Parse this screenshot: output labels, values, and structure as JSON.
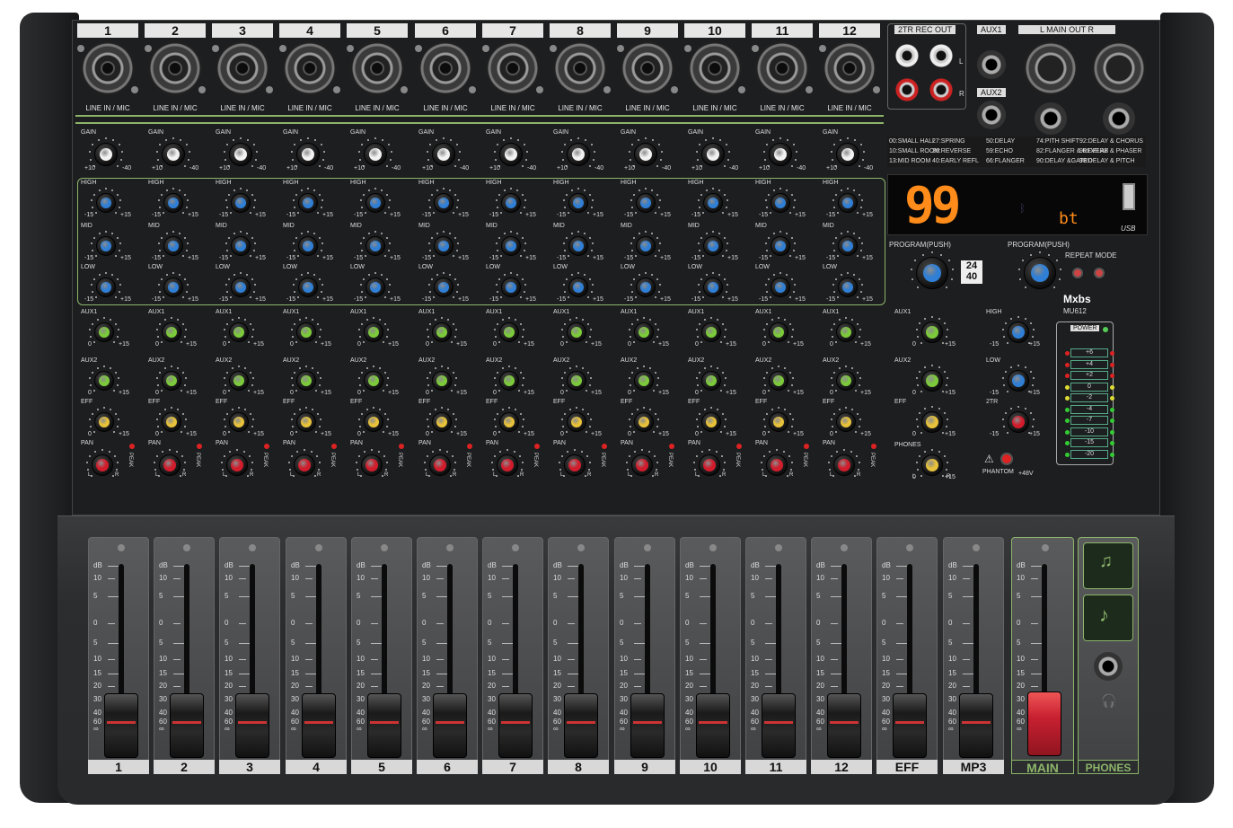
{
  "channels": [
    "1",
    "2",
    "3",
    "4",
    "5",
    "6",
    "7",
    "8",
    "9",
    "10",
    "11",
    "12"
  ],
  "faders": [
    "1",
    "2",
    "3",
    "4",
    "5",
    "6",
    "7",
    "8",
    "9",
    "10",
    "11",
    "12",
    "EFF",
    "MP3"
  ],
  "master": {
    "main": "MAIN",
    "phones": "PHONES"
  },
  "labels": {
    "line_in_mic": "LINE IN / MIC",
    "gain": "GAIN",
    "gain_min": "+10",
    "gain_max": "-40",
    "high": "HIGH",
    "mid": "MID",
    "low": "LOW",
    "eq_min": "-15",
    "eq_max": "+15",
    "aux1": "AUX1",
    "aux2": "AUX2",
    "eff": "EFF",
    "pan": "PAN",
    "peak": "PEAK",
    "send_min": "0",
    "send_max": "+15",
    "pan_l": "L",
    "pan_r": "R",
    "tr_rec_out": "2TR  REC OUT",
    "aux1_out": "AUX1",
    "aux2_out": "AUX2",
    "main_out": "L    MAIN OUT    R",
    "jack_l": "L",
    "jack_r": "R"
  },
  "effects": [
    "00:SMALL HALL",
    "27:SPRING",
    "50:DELAY",
    "74:PITH SHIFT",
    "92:DELAY & CHORUS",
    "10:SMALL ROOM",
    "36:REVERSE",
    "59:ECHO",
    "82:FLANGER & REVERB",
    "96:DELAY & PHASER",
    "13:MID ROOM",
    "40:EARLY REFL",
    "66:FLANGER",
    "90:DELAY &GATED",
    "98:DELAY & PITCH"
  ],
  "display": {
    "value": "99",
    "mode": "bt",
    "bluetooth_icon": "bluetooth-icon"
  },
  "player": {
    "program_push_1": "PROGRAM(PUSH)",
    "program_push_2": "PROGRAM(PUSH)",
    "repeat_mode": "REPEAT MODE",
    "usb": "USB",
    "bit_badge_top": "24",
    "bit_badge_bottom": "40"
  },
  "master_section": {
    "aux1": "AUX1",
    "aux2": "AUX2",
    "eff": "EFF",
    "phones": "PHONES",
    "high": "HIGH",
    "low": "LOW",
    "tr2": "2TR",
    "phantom": "PHANTOM",
    "v48": "+48V",
    "send_min": "0",
    "send_max": "+15",
    "eq_min": "-15",
    "eq_max": "+15",
    "phones_l": "L",
    "phones_r": "R"
  },
  "brand": {
    "name": "Mxbs",
    "model": "MU612"
  },
  "meter": {
    "power": "POWER",
    "levels": [
      "+6",
      "+4",
      "+2",
      "0",
      "-2",
      "-4",
      "-7",
      "-10",
      "-15",
      "-20"
    ]
  },
  "fader_scale": [
    "dB",
    "10",
    "5",
    "0",
    "5",
    "10",
    "15",
    "20",
    "30",
    "40",
    "60",
    "∞"
  ],
  "colors": {
    "panel": "#1d1e20",
    "accent_green": "#8db56a",
    "knob_blue": "#2f7fd6",
    "knob_green": "#7ccb3a",
    "knob_yellow": "#e8c23a",
    "knob_red": "#d21c2c",
    "display_orange": "#ff8c1a",
    "master_cap": "#c82030"
  }
}
